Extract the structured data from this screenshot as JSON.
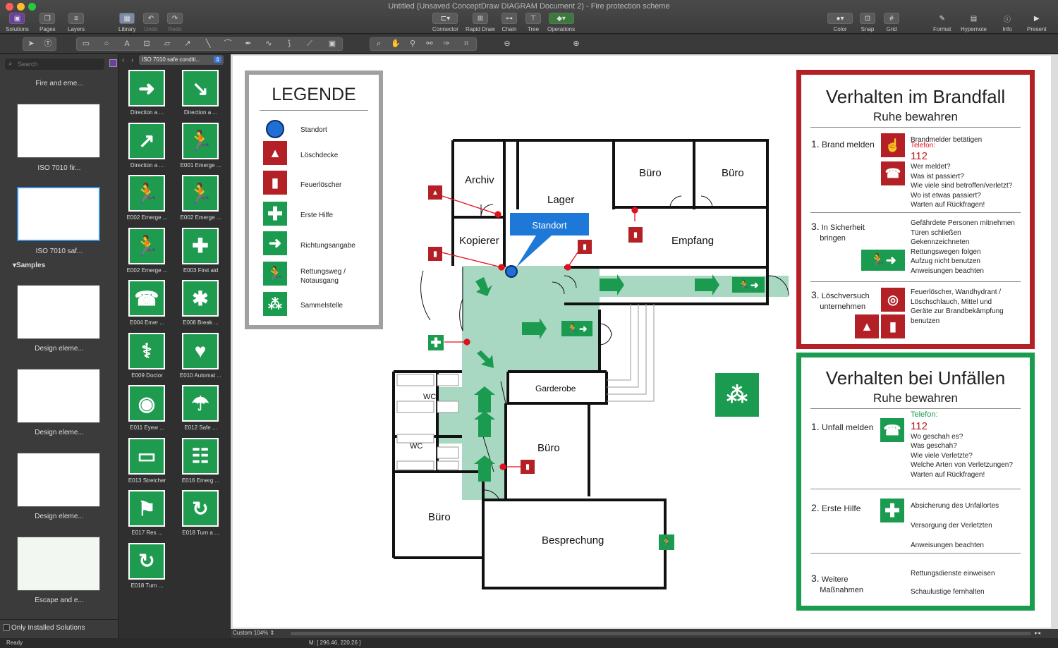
{
  "window": {
    "title": "Untitled (Unsaved ConceptDraw DIAGRAM Document 2) - Fire protection scheme"
  },
  "toolbar": {
    "solutions": "Solutions",
    "pages": "Pages",
    "layers": "Layers",
    "library": "Library",
    "undo": "Undo",
    "redo": "Redo",
    "connector": "Connector",
    "rapid_draw": "Rapid Draw",
    "chain": "Chain",
    "tree": "Tree",
    "operations": "Operations",
    "color": "Color",
    "snap": "Snap",
    "grid": "Grid",
    "format": "Format",
    "hypernote": "Hypernote",
    "info": "Info",
    "present": "Present"
  },
  "left": {
    "search_placeholder": "Search",
    "items": [
      "Fire and eme...",
      "ISO 7010 fir...",
      "ISO 7010 saf..."
    ],
    "samples_header": "Samples",
    "samples": [
      "Design eleme...",
      "Design eleme...",
      "Design eleme...",
      "Escape and e..."
    ],
    "only_installed": "Only Installed Solutions"
  },
  "library": {
    "selected": "ISO 7010 safe conditi...",
    "items": [
      {
        "label": "Direction a ...",
        "glyph": "➜"
      },
      {
        "label": "Direction a ...",
        "glyph": "↘"
      },
      {
        "label": "Direction a ...",
        "glyph": "↗"
      },
      {
        "label": "E001 Emerge ...",
        "glyph": "🏃"
      },
      {
        "label": "E002 Emerge ...",
        "glyph": "🏃"
      },
      {
        "label": "E002 Emerge ...",
        "glyph": "🏃"
      },
      {
        "label": "E002 Emerge ...",
        "glyph": "🏃"
      },
      {
        "label": "E003 First aid",
        "glyph": "✚"
      },
      {
        "label": "E004 Emer ...",
        "glyph": "☎"
      },
      {
        "label": "E008 Break ...",
        "glyph": "✱"
      },
      {
        "label": "E009 Doctor",
        "glyph": "⚕"
      },
      {
        "label": "E010 Automat ...",
        "glyph": "♥"
      },
      {
        "label": "E011 Eyew ...",
        "glyph": "◉"
      },
      {
        "label": "E012 Safe ...",
        "glyph": "☂"
      },
      {
        "label": "E013 Stretcher",
        "glyph": "▭"
      },
      {
        "label": "E016 Emerg ...",
        "glyph": "☷"
      },
      {
        "label": "E017 Res ...",
        "glyph": "⚑"
      },
      {
        "label": "E018 Turn a ...",
        "glyph": "↻"
      },
      {
        "label": "E018 Turn ...",
        "glyph": "↻"
      }
    ]
  },
  "legend": {
    "title": "LEGENDE",
    "items": [
      "Standort",
      "Löschdecke",
      "Feuerlöscher",
      "Erste Hilfe",
      "Richtungsangabe",
      "Rettungsweg /",
      "Notausgang",
      "Sammelstelle"
    ]
  },
  "plan": {
    "rooms": {
      "archiv": "Archiv",
      "lager": "Lager",
      "buero1": "Büro",
      "buero2": "Büro",
      "empfang": "Empfang",
      "kopierer": "Kopierer",
      "garderobe": "Garderobe",
      "wc1": "WC",
      "wc2": "WC",
      "buero3": "Büro",
      "buero4": "Büro",
      "besprechung": "Besprechung"
    },
    "standort": "Standort"
  },
  "fire_panel": {
    "title": "Verhalten im Brandfall",
    "subtitle": "Ruhe bewahren",
    "s1_num": "1.",
    "s1_label": "Brand melden",
    "s1_lines": [
      "Brandmelder betätigen",
      "Telefon:",
      "112",
      "Wer meldet?",
      "Was ist passiert?",
      "Wie viele sind betroffen/verletzt?",
      "Wo ist etwas passiert?",
      "Warten auf Rückfragen!"
    ],
    "s3_num": "3.",
    "s3_label1": "In Sicherheit",
    "s3_label2": "bringen",
    "s3_lines": [
      "Gefährdete Personen mitnehmen",
      "Türen schließen",
      "Gekennzeichneten",
      "Rettungswegen folgen",
      "Aufzug nicht benutzen",
      "Anweisungen beachten"
    ],
    "s4_num": "3.",
    "s4_label1": "Löschversuch",
    "s4_label2": "unternehmen",
    "s4_lines": [
      "Feuerlöscher, Wandhydrant /",
      "Löschschlauch, Mittel und",
      "Geräte zur Brandbekämpfung",
      "benutzen"
    ]
  },
  "accident_panel": {
    "title": "Verhalten bei Unfällen",
    "subtitle": "Ruhe bewahren",
    "a1_num": "1.",
    "a1_label": "Unfall melden",
    "a1_lines": [
      "Telefon:",
      "112",
      "Wo geschah es?",
      "Was geschah?",
      "Wie viele Verletzte?",
      "Welche Arten von Verletzungen?",
      "Warten auf Rückfragen!"
    ],
    "a2_num": "2.",
    "a2_label": "Erste Hilfe",
    "a2_lines": [
      "Absicherung des Unfallortes",
      "Versorgung der Verletzten",
      "Anweisungen beachten"
    ],
    "a3_num": "3.",
    "a3_label1": "Weitere",
    "a3_label2": "Maßnahmen",
    "a3_lines": [
      "Rettungsdienste einweisen",
      "Schaulustige fernhalten"
    ]
  },
  "status": {
    "ready": "Ready",
    "zoom": "Custom 104%",
    "mouse": "M: [ 296.46, 220.26 ]"
  },
  "colors": {
    "green": "#1a9b4f",
    "red": "#b32025",
    "route": "#a8d8c1",
    "standort": "#1f6fd6",
    "callout": "#1e78d8"
  }
}
